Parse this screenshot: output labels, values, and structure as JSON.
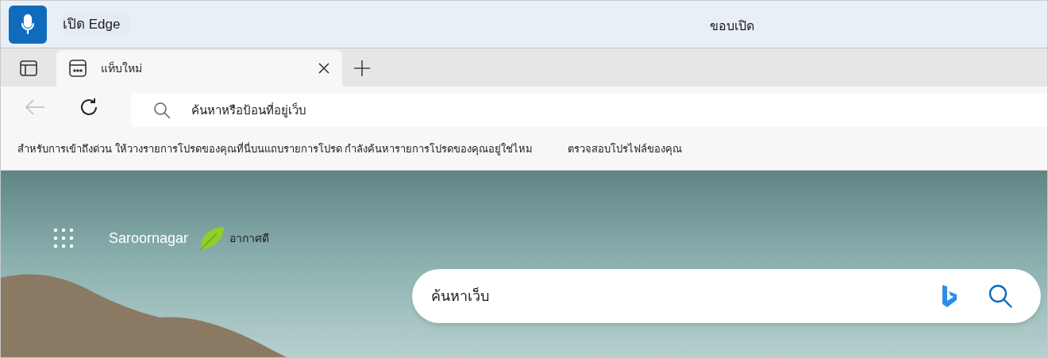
{
  "voice_bar": {
    "button_label": "เปิด Edge",
    "center_text": "ขอบเปิด"
  },
  "tabs": [
    {
      "label": "แท็บใหม่",
      "selected": true
    }
  ],
  "toolbar": {
    "back_disabled": true,
    "address": {
      "placeholder": "ค้นหาหรือป้อนที่อยู่เว็บ"
    }
  },
  "favorites_bar": {
    "message": "สำหรับการเข้าถึงด่วน ให้วางรายการโปรดของคุณที่นี่บนแถบรายการโปรด กำลังค้นหารายการโปรดของคุณอยู่ใช่ไหม",
    "link": "ตรวจสอบโปรไฟล์ของคุณ"
  },
  "new_tab_page": {
    "location": "Saroornagar",
    "air_quality": "อากาศดี",
    "search": {
      "placeholder": "ค้นหาเว็บ"
    }
  }
}
